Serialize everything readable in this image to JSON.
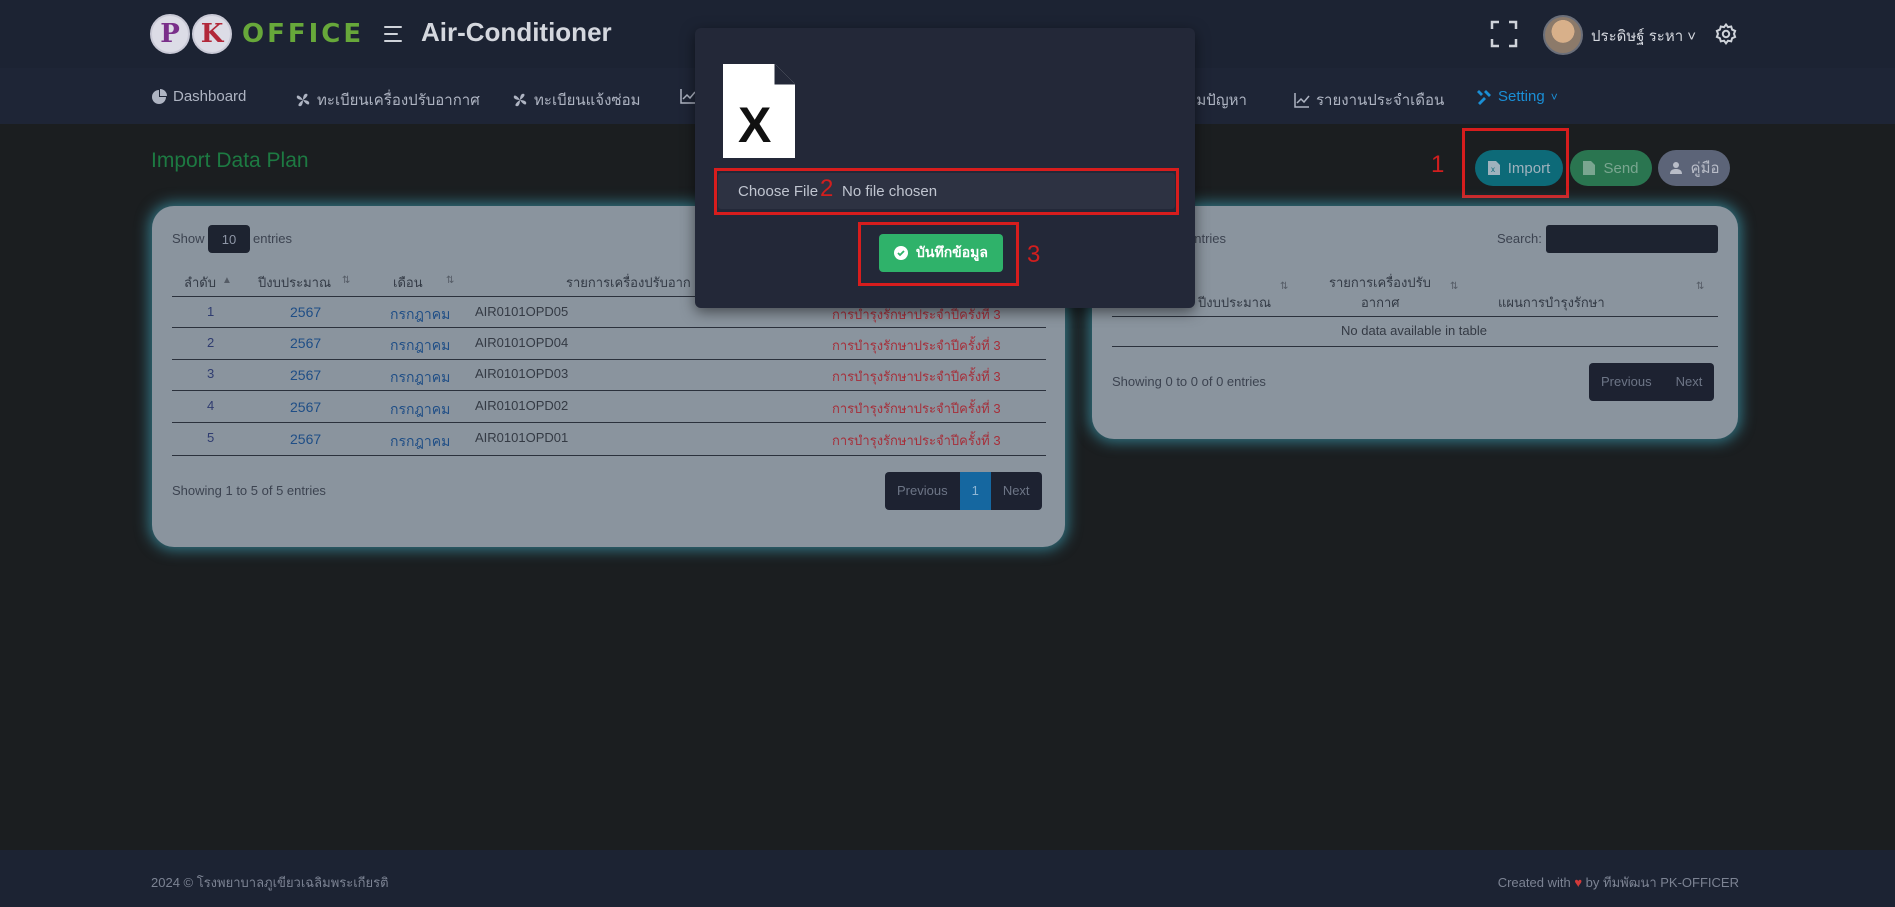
{
  "header": {
    "logo_letters": [
      "P",
      "K"
    ],
    "logo_word": "OFFICE",
    "app_title": "Air-Conditioner",
    "user_name": "ประดิษฐ์ ระหา ˅"
  },
  "nav": {
    "items": [
      {
        "label": "Dashboard",
        "icon": "pie-chart-icon"
      },
      {
        "label": "ทะเบียนเครื่องปรับอากาศ",
        "icon": "fan-icon"
      },
      {
        "label": "ทะเบียนแจ้งซ่อม",
        "icon": "fan-icon"
      },
      {
        "label": "ามปัญหา",
        "icon": "line-chart-icon"
      },
      {
        "label": "รายงานประจำเดือน",
        "icon": "line-chart-icon"
      },
      {
        "label": "Setting",
        "icon": "tools-icon",
        "active": true
      }
    ]
  },
  "page": {
    "title": "Import Data Plan",
    "buttons": {
      "import": "Import",
      "send": "Send",
      "manual": "คู่มือ"
    }
  },
  "annotations": [
    "1",
    "2",
    "3"
  ],
  "left_table": {
    "show_label": "Show",
    "length_value": "10",
    "entries_label": "entries",
    "headers": [
      "ลำดับ",
      "ปีงบประมาณ",
      "เดือน",
      "รายการเครื่องปรับอาก"
    ],
    "rows": [
      {
        "no": "1",
        "year": "2567",
        "month": "กรกฎาคม",
        "code": "AIR0101OPD05",
        "plan": "การบำรุงรักษาประจำปีครั้งที่ 3"
      },
      {
        "no": "2",
        "year": "2567",
        "month": "กรกฎาคม",
        "code": "AIR0101OPD04",
        "plan": "การบำรุงรักษาประจำปีครั้งที่ 3"
      },
      {
        "no": "3",
        "year": "2567",
        "month": "กรกฎาคม",
        "code": "AIR0101OPD03",
        "plan": "การบำรุงรักษาประจำปีครั้งที่ 3"
      },
      {
        "no": "4",
        "year": "2567",
        "month": "กรกฎาคม",
        "code": "AIR0101OPD02",
        "plan": "การบำรุงรักษาประจำปีครั้งที่ 3"
      },
      {
        "no": "5",
        "year": "2567",
        "month": "กรกฎาคม",
        "code": "AIR0101OPD01",
        "plan": "การบำรุงรักษาประจำปีครั้งที่ 3"
      }
    ],
    "info": "Showing 1 to 5 of 5 entries",
    "pager": {
      "prev": "Previous",
      "page": "1",
      "next": "Next"
    }
  },
  "right_table": {
    "entries_label": "entries",
    "search_label": "Search:",
    "headers": {
      "year": "ปีงบประมาณ",
      "item_line1": "รายการเครื่องปรับ",
      "item_line2": "อากาศ",
      "plan": "แผนการบำรุงรักษา"
    },
    "empty": "No data available in table",
    "info": "Showing 0 to 0 of 0 entries",
    "pager": {
      "prev": "Previous",
      "next": "Next"
    }
  },
  "modal": {
    "file_icon_letter": "X",
    "choose_label": "Choose File",
    "file_status": "No file chosen",
    "save_label": "บันทึกข้อมูล"
  },
  "footer": {
    "left": "2024 © โรงพยาบาลภูเขียวเฉลิมพระเกียรติ",
    "right_prefix": "Created with",
    "right_suffix": "by ทีมพัฒนา PK-OFFICER"
  },
  "colors": {
    "accent": "#1a8fd6",
    "import_highlight": "#d71d1d",
    "save": "#2fb26a"
  }
}
